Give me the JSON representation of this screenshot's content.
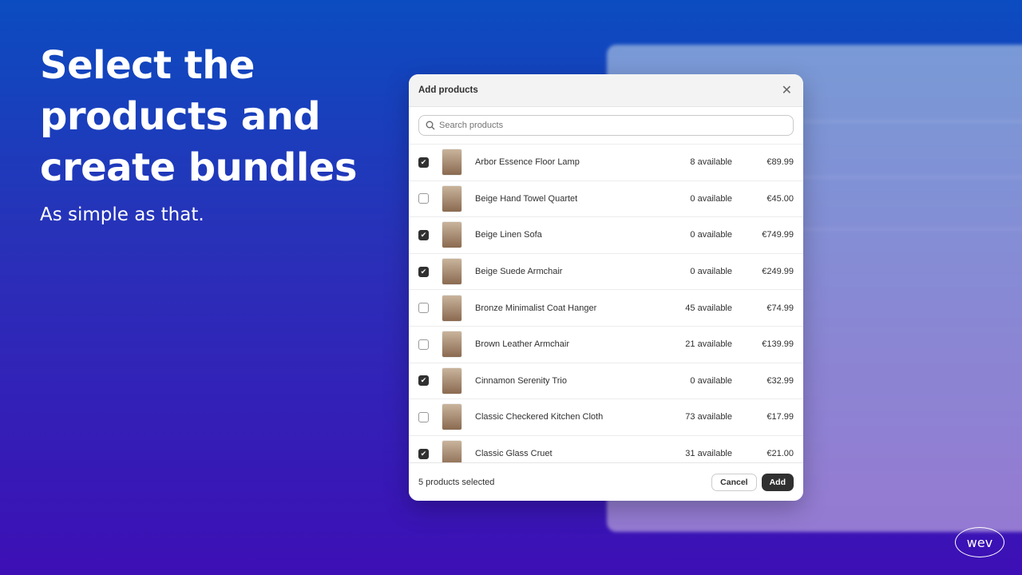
{
  "hero": {
    "title": "Select the products and create bundles",
    "subtitle": "As simple as that."
  },
  "modal": {
    "title": "Add products",
    "search_placeholder": "Search products",
    "products": [
      {
        "name": "Arbor Essence Floor Lamp",
        "available": "8 available",
        "price": "€89.99",
        "checked": true
      },
      {
        "name": "Beige Hand Towel Quartet",
        "available": "0 available",
        "price": "€45.00",
        "checked": false
      },
      {
        "name": "Beige Linen Sofa",
        "available": "0 available",
        "price": "€749.99",
        "checked": true
      },
      {
        "name": "Beige Suede Armchair",
        "available": "0 available",
        "price": "€249.99",
        "checked": true
      },
      {
        "name": "Bronze Minimalist Coat Hanger",
        "available": "45 available",
        "price": "€74.99",
        "checked": false
      },
      {
        "name": "Brown Leather Armchair",
        "available": "21 available",
        "price": "€139.99",
        "checked": false
      },
      {
        "name": "Cinnamon Serenity Trio",
        "available": "0 available",
        "price": "€32.99",
        "checked": true
      },
      {
        "name": "Classic Checkered Kitchen Cloth",
        "available": "73 available",
        "price": "€17.99",
        "checked": false
      },
      {
        "name": "Classic Glass Cruet",
        "available": "31 available",
        "price": "€21.00",
        "checked": true
      }
    ],
    "selected_count": "5 products selected",
    "cancel_label": "Cancel",
    "add_label": "Add"
  },
  "logo": "wev",
  "icons": {
    "close": "close-icon",
    "search": "search-icon",
    "check": "checkmark-icon"
  }
}
